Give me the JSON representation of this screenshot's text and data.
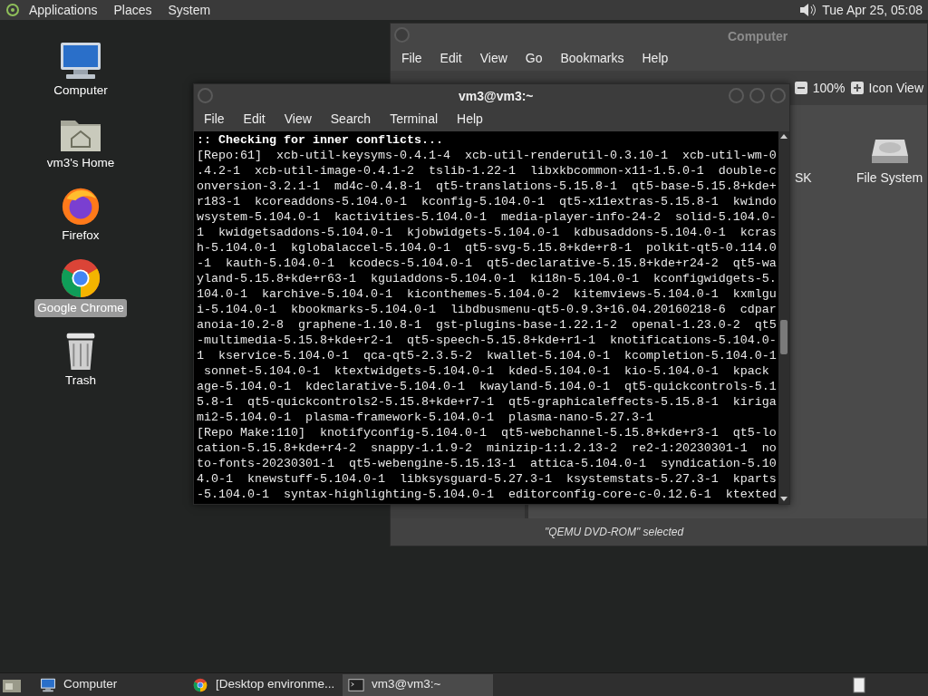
{
  "top_panel": {
    "menus": [
      "Applications",
      "Places",
      "System"
    ],
    "clock": "Tue Apr 25, 05:08"
  },
  "desktop_icons": [
    {
      "label": "Computer",
      "kind": "computer",
      "selected": false
    },
    {
      "label": "vm3's Home",
      "kind": "home",
      "selected": false
    },
    {
      "label": "Firefox",
      "kind": "firefox",
      "selected": false
    },
    {
      "label": "Google Chrome",
      "kind": "chrome",
      "selected": true
    },
    {
      "label": "Trash",
      "kind": "trash",
      "selected": false
    }
  ],
  "file_manager": {
    "title": "Computer",
    "menu": [
      "File",
      "Edit",
      "View",
      "Go",
      "Bookmarks",
      "Help"
    ],
    "zoom": "100%",
    "view_mode": "Icon View",
    "items": [
      {
        "label": "SK",
        "kind": "cut"
      },
      {
        "label": "File System",
        "kind": "drive"
      }
    ],
    "status": "\"QEMU DVD-ROM\" selected"
  },
  "terminal": {
    "title": "vm3@vm3:~",
    "menu": [
      "File",
      "Edit",
      "View",
      "Search",
      "Terminal",
      "Help"
    ],
    "lines": [
      {
        "text": ":: Checking for inner conflicts...",
        "bold": true
      },
      {
        "text": "[Repo:61]  xcb-util-keysyms-0.4.1-4  xcb-util-renderutil-0.3.10-1  xcb-util-wm-0",
        "bold": false
      },
      {
        "text": ".4.2-1  xcb-util-image-0.4.1-2  tslib-1.22-1  libxkbcommon-x11-1.5.0-1  double-c",
        "bold": false
      },
      {
        "text": "onversion-3.2.1-1  md4c-0.4.8-1  qt5-translations-5.15.8-1  qt5-base-5.15.8+kde+",
        "bold": false
      },
      {
        "text": "r183-1  kcoreaddons-5.104.0-1  kconfig-5.104.0-1  qt5-x11extras-5.15.8-1  kwindo",
        "bold": false
      },
      {
        "text": "wsystem-5.104.0-1  kactivities-5.104.0-1  media-player-info-24-2  solid-5.104.0-",
        "bold": false
      },
      {
        "text": "1  kwidgetsaddons-5.104.0-1  kjobwidgets-5.104.0-1  kdbusaddons-5.104.0-1  kcras",
        "bold": false
      },
      {
        "text": "h-5.104.0-1  kglobalaccel-5.104.0-1  qt5-svg-5.15.8+kde+r8-1  polkit-qt5-0.114.0",
        "bold": false
      },
      {
        "text": "-1  kauth-5.104.0-1  kcodecs-5.104.0-1  qt5-declarative-5.15.8+kde+r24-2  qt5-wa",
        "bold": false
      },
      {
        "text": "yland-5.15.8+kde+r63-1  kguiaddons-5.104.0-1  ki18n-5.104.0-1  kconfigwidgets-5.",
        "bold": false
      },
      {
        "text": "104.0-1  karchive-5.104.0-1  kiconthemes-5.104.0-2  kitemviews-5.104.0-1  kxmlgu",
        "bold": false
      },
      {
        "text": "i-5.104.0-1  kbookmarks-5.104.0-1  libdbusmenu-qt5-0.9.3+16.04.20160218-6  cdpar",
        "bold": false
      },
      {
        "text": "anoia-10.2-8  graphene-1.10.8-1  gst-plugins-base-1.22.1-2  openal-1.23.0-2  qt5",
        "bold": false
      },
      {
        "text": "-multimedia-5.15.8+kde+r2-1  qt5-speech-5.15.8+kde+r1-1  knotifications-5.104.0-",
        "bold": false
      },
      {
        "text": "1  kservice-5.104.0-1  qca-qt5-2.3.5-2  kwallet-5.104.0-1  kcompletion-5.104.0-1",
        "bold": false
      },
      {
        "text": " sonnet-5.104.0-1  ktextwidgets-5.104.0-1  kded-5.104.0-1  kio-5.104.0-1  kpack",
        "bold": false
      },
      {
        "text": "age-5.104.0-1  kdeclarative-5.104.0-1  kwayland-5.104.0-1  qt5-quickcontrols-5.1",
        "bold": false
      },
      {
        "text": "5.8-1  qt5-quickcontrols2-5.15.8+kde+r7-1  qt5-graphicaleffects-5.15.8-1  kiriga",
        "bold": false
      },
      {
        "text": "mi2-5.104.0-1  plasma-framework-5.104.0-1  plasma-nano-5.27.3-1",
        "bold": false
      },
      {
        "text": "[Repo Make:110]  knotifyconfig-5.104.0-1  qt5-webchannel-5.15.8+kde+r3-1  qt5-lo",
        "bold": false
      },
      {
        "text": "cation-5.15.8+kde+r4-2  snappy-1.1.9-2  minizip-1:1.2.13-2  re2-1:20230301-1  no",
        "bold": false
      },
      {
        "text": "to-fonts-20230301-1  qt5-webengine-5.15.13-1  attica-5.104.0-1  syndication-5.10",
        "bold": false
      },
      {
        "text": "4.0-1  knewstuff-5.104.0-1  libksysguard-5.27.3-1  ksystemstats-5.27.3-1  kparts",
        "bold": false
      },
      {
        "text": "-5.104.0-1  syntax-highlighting-5.104.0-1  editorconfig-core-c-0.12.6-1  ktexted",
        "bold": false
      }
    ]
  },
  "taskbar": {
    "tasks": [
      {
        "label": "Computer",
        "kind": "computer",
        "selected": false
      },
      {
        "label": "[Desktop environme...",
        "kind": "chrome",
        "selected": false
      },
      {
        "label": "vm3@vm3:~",
        "kind": "terminal",
        "selected": true
      }
    ]
  }
}
